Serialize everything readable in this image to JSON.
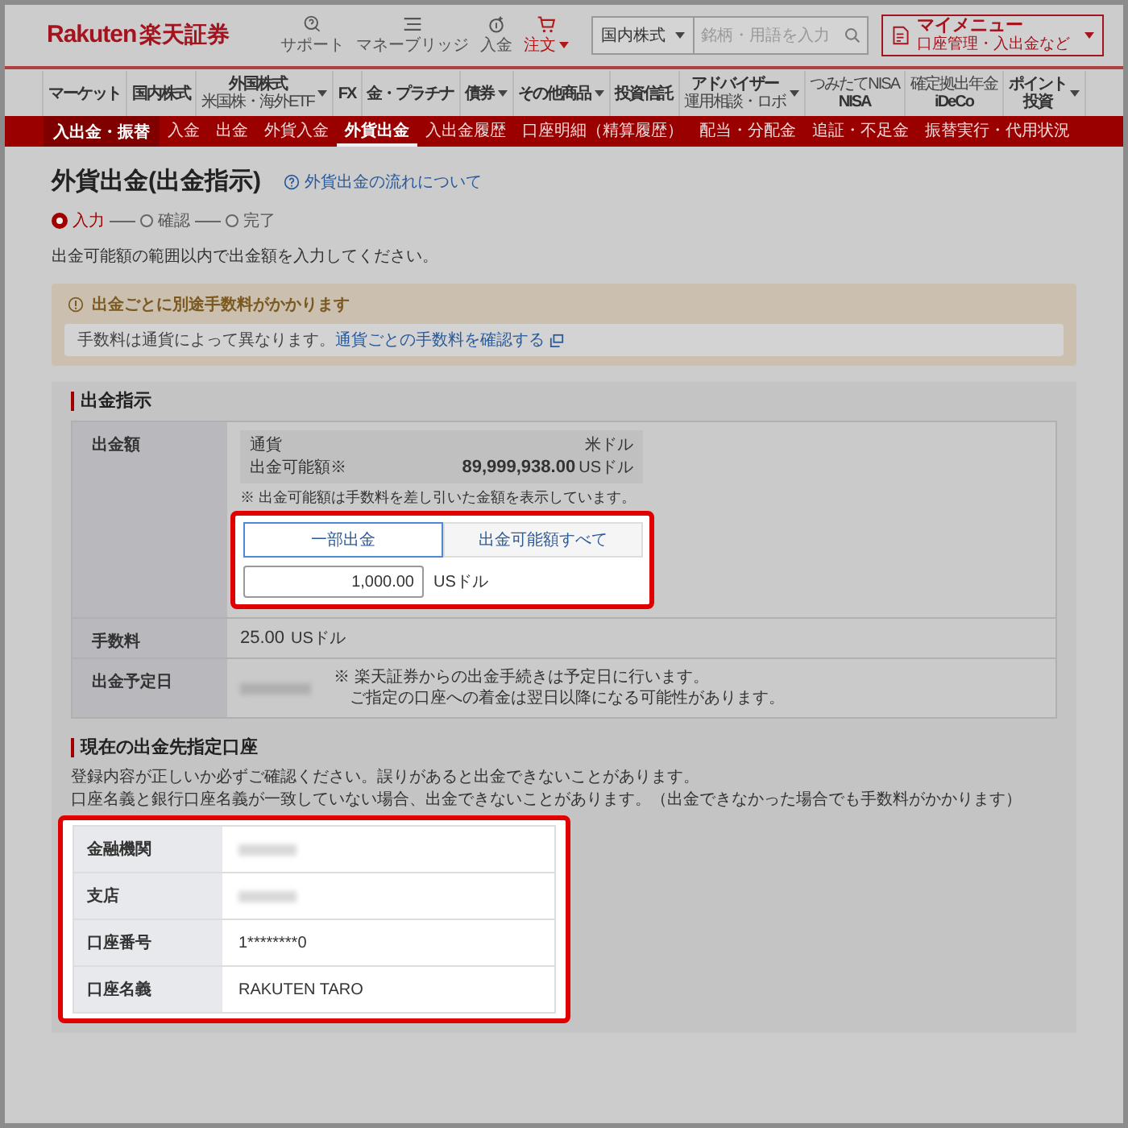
{
  "header": {
    "logo_latin": "Rakuten",
    "logo_kanji": "楽天証券",
    "utilities": [
      {
        "kind": "support",
        "label": "サポート",
        "accent": false,
        "dropdown": false
      },
      {
        "kind": "bridge",
        "label": "マネーブリッジ",
        "accent": false,
        "dropdown": false
      },
      {
        "kind": "deposit",
        "label": "入金",
        "accent": false,
        "dropdown": false
      },
      {
        "kind": "cart",
        "label": "注文",
        "accent": true,
        "dropdown": true
      }
    ],
    "search": {
      "category": "国内株式",
      "placeholder": "銘柄・用語を入力"
    },
    "my_menu": {
      "title": "マイメニュー",
      "subtitle": "口座管理・入出金など"
    }
  },
  "nav": {
    "items": [
      {
        "lines": [
          {
            "kind": "main",
            "text": "マーケット"
          }
        ],
        "dropdown": false
      },
      {
        "lines": [
          {
            "kind": "main",
            "text": "国内株式"
          }
        ],
        "dropdown": false
      },
      {
        "lines": [
          {
            "kind": "main",
            "text": "外国株式"
          },
          {
            "kind": "small",
            "text": "米国株・海外ETF"
          }
        ],
        "dropdown": true
      },
      {
        "lines": [
          {
            "kind": "main",
            "text": "FX"
          }
        ],
        "dropdown": false
      },
      {
        "lines": [
          {
            "kind": "main",
            "text": "金・プラチナ"
          }
        ],
        "dropdown": false
      },
      {
        "lines": [
          {
            "kind": "main",
            "text": "債券"
          }
        ],
        "dropdown": true
      },
      {
        "lines": [
          {
            "kind": "main",
            "text": "その他商品"
          }
        ],
        "dropdown": true
      },
      {
        "lines": [
          {
            "kind": "main",
            "text": "投資信託"
          }
        ],
        "dropdown": false
      },
      {
        "lines": [
          {
            "kind": "main",
            "text": "アドバイザー"
          },
          {
            "kind": "small",
            "text": "運用相談・ロボ"
          }
        ],
        "dropdown": true
      },
      {
        "lines": [
          {
            "kind": "small",
            "text": "つみたてNISA"
          },
          {
            "kind": "main",
            "text": "NISA"
          }
        ],
        "dropdown": false
      },
      {
        "lines": [
          {
            "kind": "small",
            "text": "確定拠出年金"
          },
          {
            "kind": "main",
            "text": "iDeCo"
          }
        ],
        "dropdown": false
      },
      {
        "lines": [
          {
            "kind": "main",
            "text": "ポイント"
          },
          {
            "kind": "main",
            "text": "投資"
          }
        ],
        "dropdown": true
      }
    ]
  },
  "subnav": {
    "title": "入出金・振替",
    "items": [
      {
        "label": "入金",
        "selected": false
      },
      {
        "label": "出金",
        "selected": false
      },
      {
        "label": "外貨入金",
        "selected": false
      },
      {
        "label": "外貨出金",
        "selected": true
      },
      {
        "label": "入出金履歴",
        "selected": false
      },
      {
        "label": "口座明細（精算履歴）",
        "selected": false
      },
      {
        "label": "配当・分配金",
        "selected": false
      },
      {
        "label": "追証・不足金",
        "selected": false
      },
      {
        "label": "振替実行・代用状況",
        "selected": false
      }
    ]
  },
  "page": {
    "title": "外貨出金(出金指示)",
    "help_link": "外貨出金の流れについて",
    "steps": [
      {
        "label": "入力",
        "selected": true
      },
      {
        "label": "確認",
        "selected": false
      },
      {
        "label": "完了",
        "selected": false
      }
    ],
    "instruction": "出金可能額の範囲以内で出金額を入力してください。"
  },
  "notice": {
    "title": "出金ごとに別途手数料がかかります",
    "text": "手数料は通貨によって異なります。",
    "link": "通貨ごとの手数料を確認する"
  },
  "instruction_section": {
    "title": "出金指示",
    "amount": {
      "label": "出金額",
      "currency_label": "通貨",
      "currency": "米ドル",
      "available_label": "出金可能額※",
      "available": "89,999,938.00",
      "available_unit": "USドル",
      "note": "※ 出金可能額は手数料を差し引いた金額を表示しています。",
      "options": [
        {
          "label": "一部出金",
          "selected": true
        },
        {
          "label": "出金可能額すべて",
          "selected": false
        }
      ],
      "value": "1,000.00",
      "unit": "USドル"
    },
    "fee": {
      "label": "手数料",
      "value": "25.00",
      "unit": "USドル"
    },
    "date": {
      "label": "出金予定日",
      "redacted": true,
      "notes": [
        "※ 楽天証券からの出金手続きは予定日に行います。",
        "ご指定の口座への着金は翌日以降になる可能性があります。"
      ]
    }
  },
  "account_section": {
    "title": "現在の出金先指定口座",
    "notes": [
      "登録内容が正しいか必ずご確認ください。誤りがあると出金できないことがあります。",
      "口座名義と銀行口座名義が一致していない場合、出金できないことがあります。（出金できなかった場合でも手数料がかかります）"
    ],
    "rows": [
      {
        "label": "金融機関",
        "redacted": true
      },
      {
        "label": "支店",
        "redacted": true
      },
      {
        "label": "口座番号",
        "redacted": false,
        "value": "1********0"
      },
      {
        "label": "口座名義",
        "redacted": false,
        "value": "RAKUTEN TARO"
      }
    ]
  }
}
